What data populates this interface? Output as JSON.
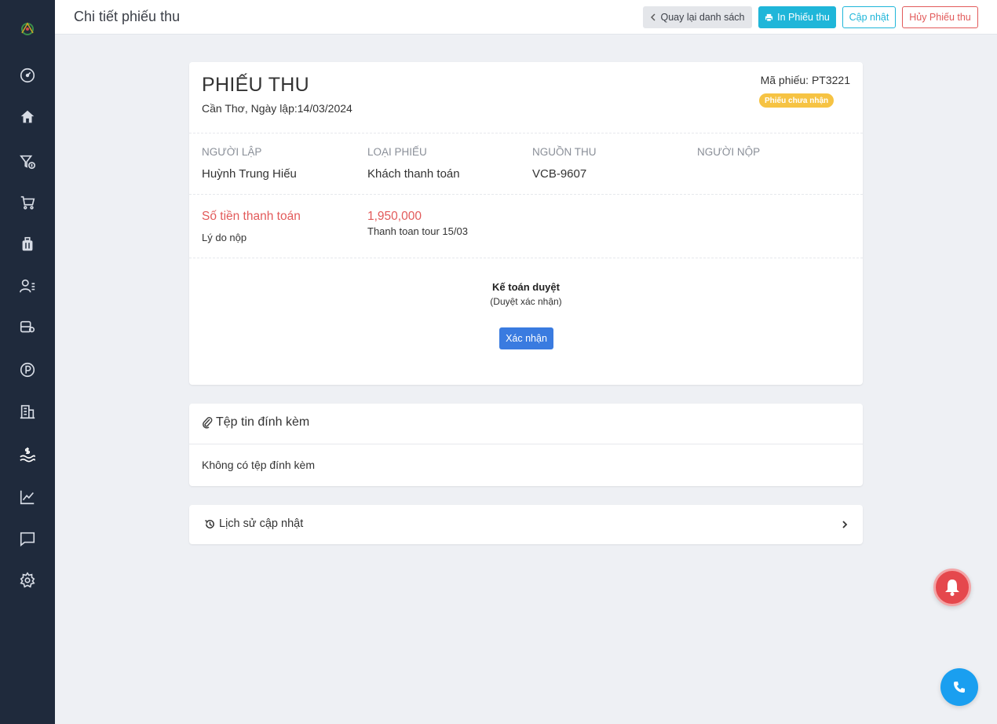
{
  "header": {
    "title": "Chi tiết phiếu thu",
    "back_label": "Quay lại danh sách",
    "print_label": "In Phiếu thu",
    "update_label": "Cập nhật",
    "cancel_label": "Hủy Phiếu thu"
  },
  "receipt": {
    "title": "PHIẾU THU",
    "place_date": "Cần Thơ, Ngày lập:14/03/2024",
    "code_text": "Mã phiếu: PT3221",
    "status_badge": "Phiếu chưa nhận",
    "fields": [
      {
        "label": "Người lập",
        "value": "Huỳnh Trung Hiếu"
      },
      {
        "label": "Loại phiếu",
        "value": "Khách thanh toán"
      },
      {
        "label": "Nguồn thu",
        "value": "VCB-9607"
      },
      {
        "label": "Người nộp",
        "value": ""
      }
    ],
    "amount_label": "Số tiền thanh toán",
    "amount_value": "1,950,000",
    "reason_label": "Lý do nộp",
    "reason_value": "Thanh toan tour 15/03",
    "approval_title": "Kế toán duyệt",
    "approval_subtitle": "(Duyệt xác nhận)",
    "confirm_label": "Xác nhận"
  },
  "attachments": {
    "title": "Tệp tin đính kèm",
    "empty_text": "Không có tệp đính kèm"
  },
  "history": {
    "title": "Lịch sử cập nhật"
  },
  "sidebar": {
    "icons": [
      "dashboard-icon",
      "home-icon",
      "filter-money-icon",
      "cart-icon",
      "luggage-icon",
      "users-list-icon",
      "bus-location-icon",
      "parking-icon",
      "building-icon",
      "finance-wave-icon",
      "chart-icon",
      "chat-icon",
      "settings-icon"
    ]
  },
  "colors": {
    "sidebar_bg": "#1f2a3c",
    "primary_cyan": "#1fb6d9",
    "danger": "#e25a5a",
    "confirm_blue": "#3a7be0",
    "badge_yellow": "#f6c343",
    "bell_red": "#e5484d",
    "phone_blue": "#1a9ff0"
  }
}
